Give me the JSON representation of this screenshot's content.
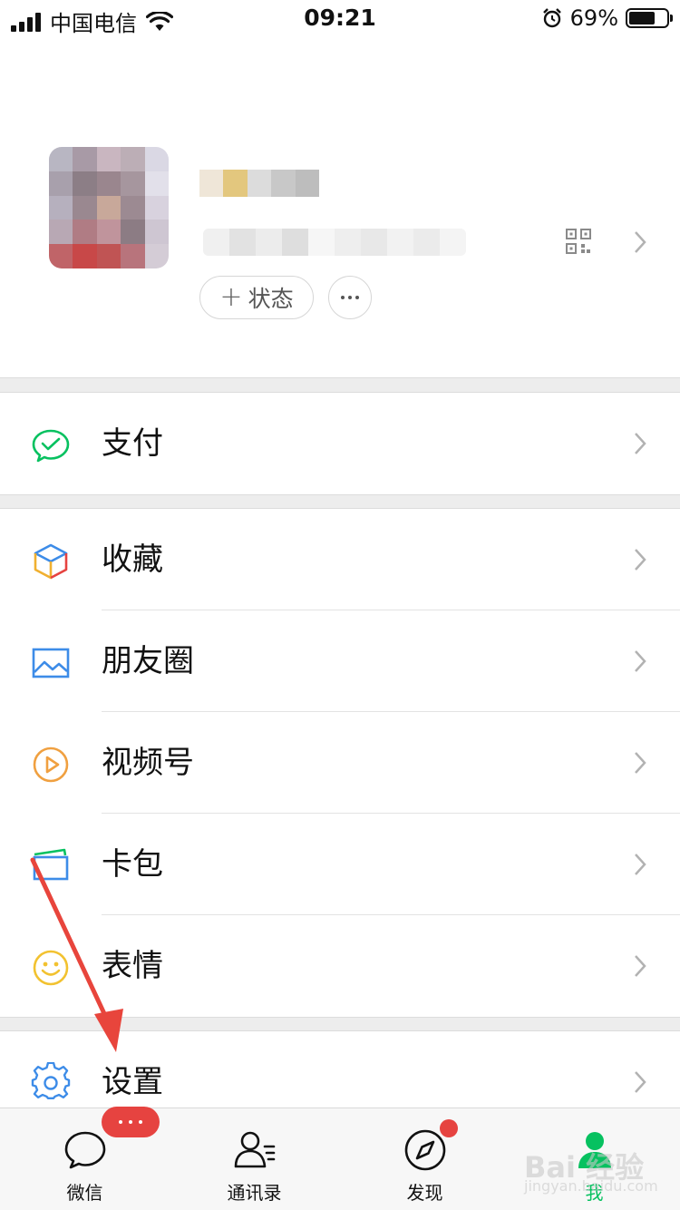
{
  "status_bar": {
    "carrier": "中国电信",
    "time": "09:21",
    "battery_percent": "69%",
    "battery_level": 0.69
  },
  "profile": {
    "status_button_plus": "+",
    "status_button_label": "状态",
    "icons": [
      "qr-code-icon",
      "chevron-right-icon",
      "more-dots-icon"
    ]
  },
  "menu": {
    "pay": "支付",
    "favorites": "收藏",
    "moments": "朋友圈",
    "channels": "视频号",
    "cards": "卡包",
    "stickers": "表情",
    "settings": "设置"
  },
  "tabbar": {
    "chats": "微信",
    "contacts": "通讯录",
    "discover": "发现",
    "me": "我"
  },
  "watermark": {
    "text": "Bai 经验",
    "sub": "jingyan.baidu.com"
  },
  "colors": {
    "accent_green": "#07c160",
    "badge_red": "#e64340",
    "annotation_arrow": "#e8453c",
    "background_gray": "#ededed"
  }
}
